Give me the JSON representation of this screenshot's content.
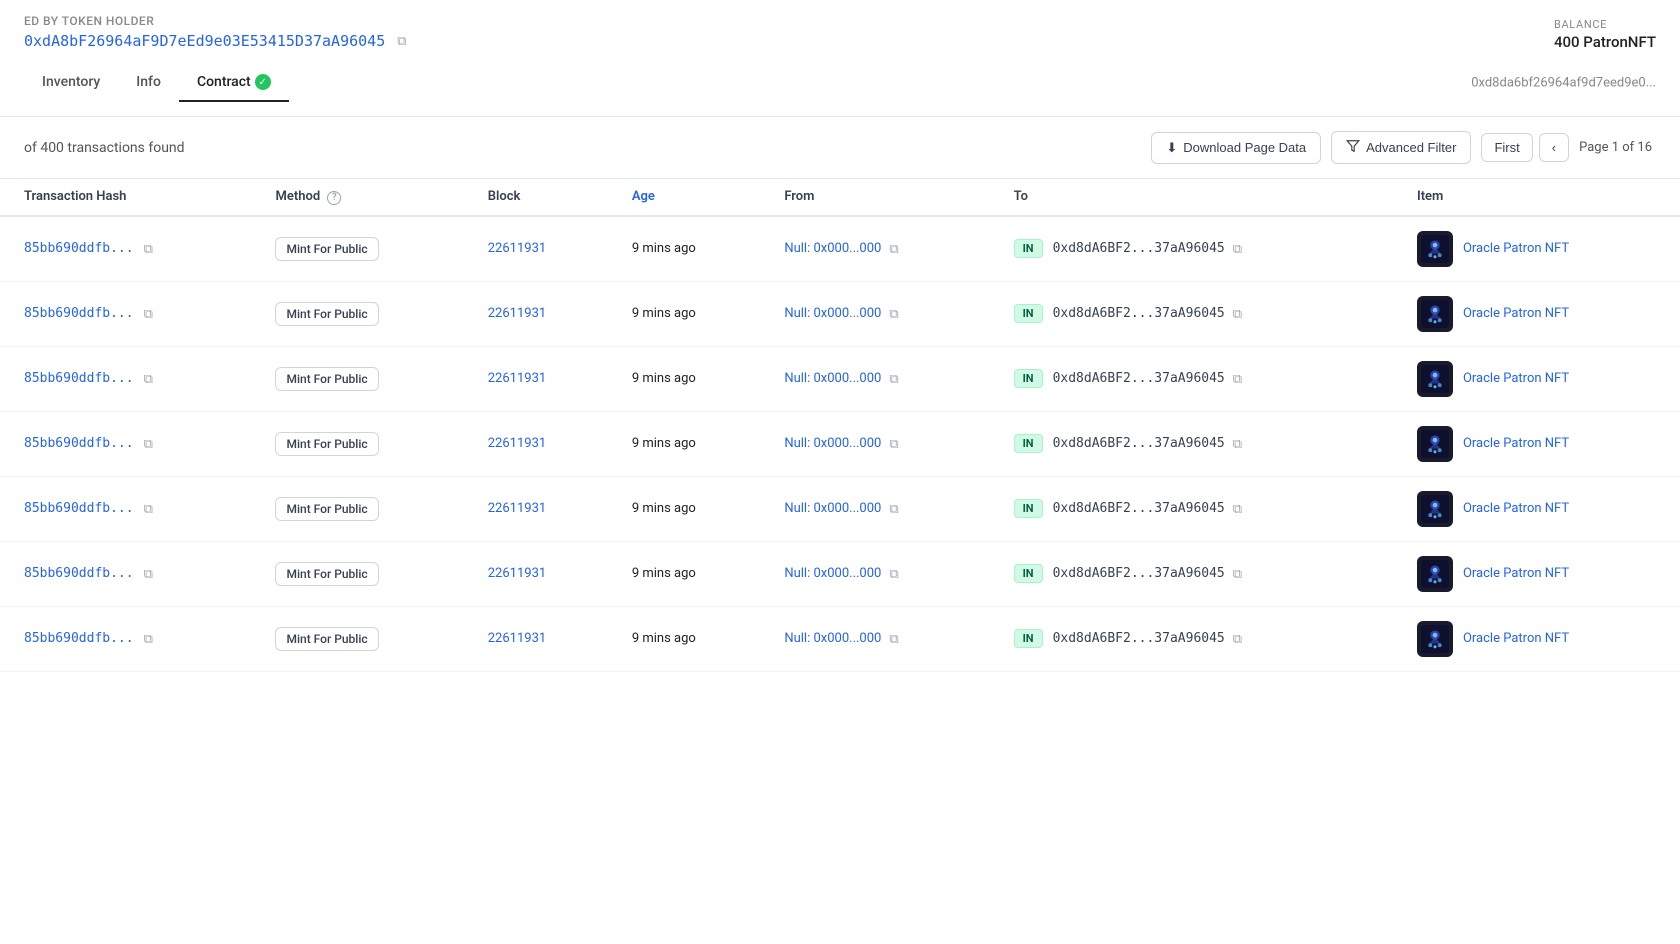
{
  "header": {
    "owner_label": "ED BY TOKEN HOLDER",
    "owner_address": "0xdA8bF26964aF9D7eEd9e03E53415D37aA96045",
    "balance_label": "BALANCE",
    "balance_value": "400 PatronNFT",
    "address_short": "0xd8da6bf26964af9d7eed9e0..."
  },
  "tabs": [
    {
      "label": "Inventory",
      "active": false
    },
    {
      "label": "Info",
      "active": false
    },
    {
      "label": "Contract",
      "active": true,
      "verified": true
    }
  ],
  "toolbar": {
    "tx_count": "of 400 transactions found",
    "download_label": "Download Page Data",
    "filter_label": "Advanced Filter",
    "first_label": "First",
    "page_info": "Page 1 of 16"
  },
  "table": {
    "columns": [
      {
        "key": "txHash",
        "label": "Transaction Hash",
        "sortable": false
      },
      {
        "key": "method",
        "label": "Method",
        "has_help": true
      },
      {
        "key": "block",
        "label": "Block",
        "sortable": false
      },
      {
        "key": "age",
        "label": "Age",
        "sortable": false,
        "highlight": true
      },
      {
        "key": "from",
        "label": "From",
        "sortable": false
      },
      {
        "key": "to",
        "label": "To",
        "sortable": false
      },
      {
        "key": "item",
        "label": "Item",
        "sortable": false
      }
    ],
    "rows": [
      {
        "txHash": "85bb690ddfb...",
        "method": "Mint For Public",
        "block": "22611931",
        "age": "9 mins ago",
        "from": "Null: 0x000...000",
        "direction": "IN",
        "to": "0xd8dA6BF2...37aA96045",
        "itemName": "Oracle Patron NFT"
      },
      {
        "txHash": "85bb690ddfb...",
        "method": "Mint For Public",
        "block": "22611931",
        "age": "9 mins ago",
        "from": "Null: 0x000...000",
        "direction": "IN",
        "to": "0xd8dA6BF2...37aA96045",
        "itemName": "Oracle Patron NFT"
      },
      {
        "txHash": "85bb690ddfb...",
        "method": "Mint For Public",
        "block": "22611931",
        "age": "9 mins ago",
        "from": "Null: 0x000...000",
        "direction": "IN",
        "to": "0xd8dA6BF2...37aA96045",
        "itemName": "Oracle Patron NFT"
      },
      {
        "txHash": "85bb690ddfb...",
        "method": "Mint For Public",
        "block": "22611931",
        "age": "9 mins ago",
        "from": "Null: 0x000...000",
        "direction": "IN",
        "to": "0xd8dA6BF2...37aA96045",
        "itemName": "Oracle Patron NFT"
      },
      {
        "txHash": "85bb690ddfb...",
        "method": "Mint For Public",
        "block": "22611931",
        "age": "9 mins ago",
        "from": "Null: 0x000...000",
        "direction": "IN",
        "to": "0xd8dA6BF2...37aA96045",
        "itemName": "Oracle Patron NFT"
      },
      {
        "txHash": "85bb690ddfb...",
        "method": "Mint For Public",
        "block": "22611931",
        "age": "9 mins ago",
        "from": "Null: 0x000...000",
        "direction": "IN",
        "to": "0xd8dA6BF2...37aA96045",
        "itemName": "Oracle Patron NFT"
      },
      {
        "txHash": "85bb690ddfb...",
        "method": "Mint For Public",
        "block": "22611931",
        "age": "9 mins ago",
        "from": "Null: 0x000...000",
        "direction": "IN",
        "to": "0xd8dA6BF2...37aA96045",
        "itemName": "Oracle Patron NFT"
      }
    ]
  },
  "icons": {
    "copy": "⧉",
    "download": "⬇",
    "filter": "⧉",
    "chevron_left": "‹",
    "check": "✓",
    "question": "?"
  }
}
